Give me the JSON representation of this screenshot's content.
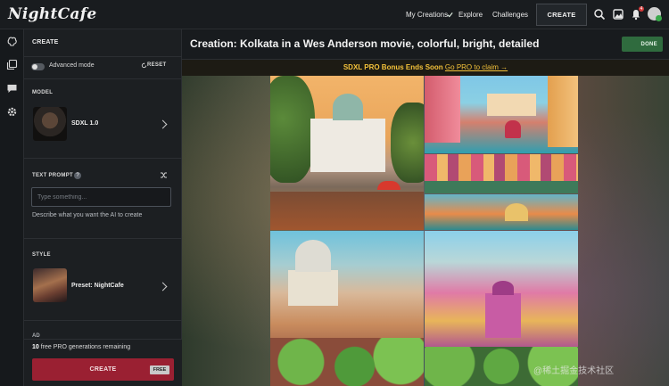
{
  "topbar": {
    "logo": "NightCafe",
    "nav": [
      "My Creations",
      "Explore",
      "Challenges"
    ],
    "create_label": "CREATE",
    "notification_count": "4"
  },
  "panel": {
    "title": "CREATE",
    "advanced_mode_label": "Advanced mode",
    "reset_label": "RESET",
    "model_section": "MODEL",
    "model_name": "SDXL 1.0",
    "prompt_section": "TEXT PROMPT",
    "prompt_placeholder": "Type something...",
    "prompt_value": "",
    "prompt_help": "Describe what you want the AI to create",
    "style_section": "STYLE",
    "style_name": "Preset: NightCafe",
    "ad_label": "AD",
    "remaining_count": "10",
    "remaining_text": " free PRO generations remaining",
    "create_label": "CREATE",
    "free_label": "FREE"
  },
  "main": {
    "title": "Creation: Kolkata in a Wes Anderson movie, colorful, bright, detailed",
    "done_label": "DONE",
    "promo_text": "SDXL PRO Bonus Ends Soon",
    "promo_link": "Go PRO to claim →"
  },
  "watermark": "@稀土掘金技术社区",
  "colors": {
    "create_button": "#9a2032",
    "done_button": "#2f6b3e",
    "promo_text": "#f4c23a"
  }
}
